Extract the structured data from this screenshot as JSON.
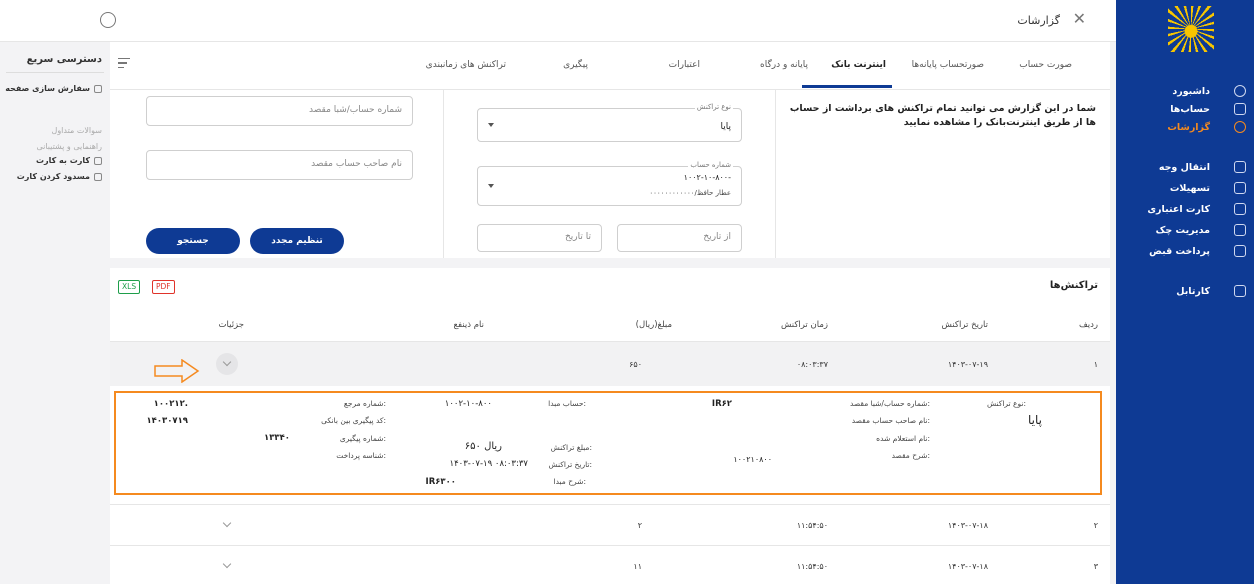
{
  "window": {
    "title": "گزارشات"
  },
  "sidebar": {
    "items": [
      {
        "label": "داشبورد",
        "icon": "dashboard-icon"
      },
      {
        "label": "حساب‌ها",
        "icon": "bank-icon"
      },
      {
        "label": "گزارشات",
        "icon": "report-icon",
        "active": true
      },
      {
        "label": "انتقال وجه",
        "icon": "transfer-icon"
      },
      {
        "label": "تسهیلات",
        "icon": "loan-icon"
      },
      {
        "label": "کارت اعتباری",
        "icon": "credit-card-icon"
      },
      {
        "label": "مدیریت چک",
        "icon": "cheque-icon"
      },
      {
        "label": "پرداخت قبض",
        "icon": "bill-icon"
      },
      {
        "label": "کارتابل",
        "icon": "cartable-icon"
      }
    ],
    "accent": "#f58a1f",
    "background": "#0e3a94"
  },
  "quick_access": {
    "title": "دسترسی سریع",
    "items": [
      {
        "label": "سفارش سازی صفحه"
      },
      {
        "label": "سوالات متداول"
      },
      {
        "label": "راهنمایی و پشتیبانی"
      },
      {
        "label": "کارت به کارت"
      },
      {
        "label": "مسدود کردن کارت"
      }
    ]
  },
  "tabs": [
    {
      "label": "صورت حساب"
    },
    {
      "label": "صورتحساب پایانه‌ها"
    },
    {
      "label": "اینترنت بانک",
      "active": true
    },
    {
      "label": "پایانه و درگاه"
    },
    {
      "label": "اعتبارات"
    },
    {
      "label": "پیگیری"
    },
    {
      "label": "تراکنش های زمانبندی"
    }
  ],
  "filter": {
    "description": "شما در این گزارش می توانید تمام تراکنش های برداشت از حساب ها از طریق اینترنت‌بانک را مشاهده نمایید",
    "transaction_type_label": "نوع تراکنش",
    "transaction_type_value": "پایا",
    "account_label": "شماره حساب",
    "account_number": "۱۰۰۲-۱۰-۸۰۰-",
    "account_owner": "۰۰۰۰۰۰۰۰۰۰۰۰/عطار حافظ",
    "from_date_placeholder": "از تاریخ",
    "to_date_placeholder": "تا تاریخ",
    "dest_account_placeholder": "شماره حساب/شبا مقصد",
    "dest_owner_placeholder": "نام صاحب حساب مقصد",
    "reset_label": "تنظیم مجدد",
    "search_label": "جستجو"
  },
  "transactions": {
    "title": "تراکنش‌ها",
    "xls_label": "XLS",
    "pdf_label": "PDF",
    "columns": [
      "ردیف",
      "تاریخ تراکنش",
      "زمان تراکنش",
      "مبلغ(ریال)",
      "نام ذینفع",
      "جزئیات"
    ],
    "rows": [
      {
        "index": "۱",
        "date": "۱۴۰۳-۰۷-۱۹",
        "time": "۰۸:۰۳:۳۷",
        "amount": "۶۵۰"
      },
      {
        "index": "۲",
        "date": "۱۴۰۳-۰۷-۱۸",
        "time": "۱۱:۵۴:۵۰",
        "amount": "۲"
      },
      {
        "index": "۳",
        "date": "۱۴۰۳-۰۷-۱۸",
        "time": "۱۱:۵۴:۵۰",
        "amount": "۱۱"
      }
    ],
    "detail": {
      "type_label": "نوع تراکنش:",
      "type_value": "پایا",
      "dest_account_label": "شماره حساب/شبا مقصد:",
      "dest_account_value": "IR۶۲",
      "dest_owner_label": "نام صاحب حساب مقصد:",
      "inquiry_name_label": "نام استعلام شده:",
      "dest_desc_label": "شرح مقصد:",
      "dest_desc_value": "۱۰۰۲۱۰۸۰۰",
      "source_account_label": "حساب مبدا:",
      "source_account_value": "۱۰۰۲-۱۰-۸۰۰",
      "amount_label": "مبلغ تراکنش:",
      "amount_value": "۶۵۰ ریال",
      "date_label": "تاریخ تراکنش:",
      "date_value": "۱۴۰۳-۰۷-۱۹ ۰۸:۰۳:۳۷",
      "source_desc_label": "شرح مبدا:",
      "source_desc_value": "IR۶۳۰۰",
      "ref_label": "شماره مرجع:",
      "ref_value": "۱۰۰۲۱۲.",
      "interbank_label": "کد پیگیری بین بانکی:",
      "interbank_value": "۱۴۰۳۰۷۱۹",
      "tracking_label": "شماره پیگیری:",
      "tracking_value": "۱۳۳۴۰",
      "payment_id_label": "شناسه پرداخت:"
    }
  }
}
